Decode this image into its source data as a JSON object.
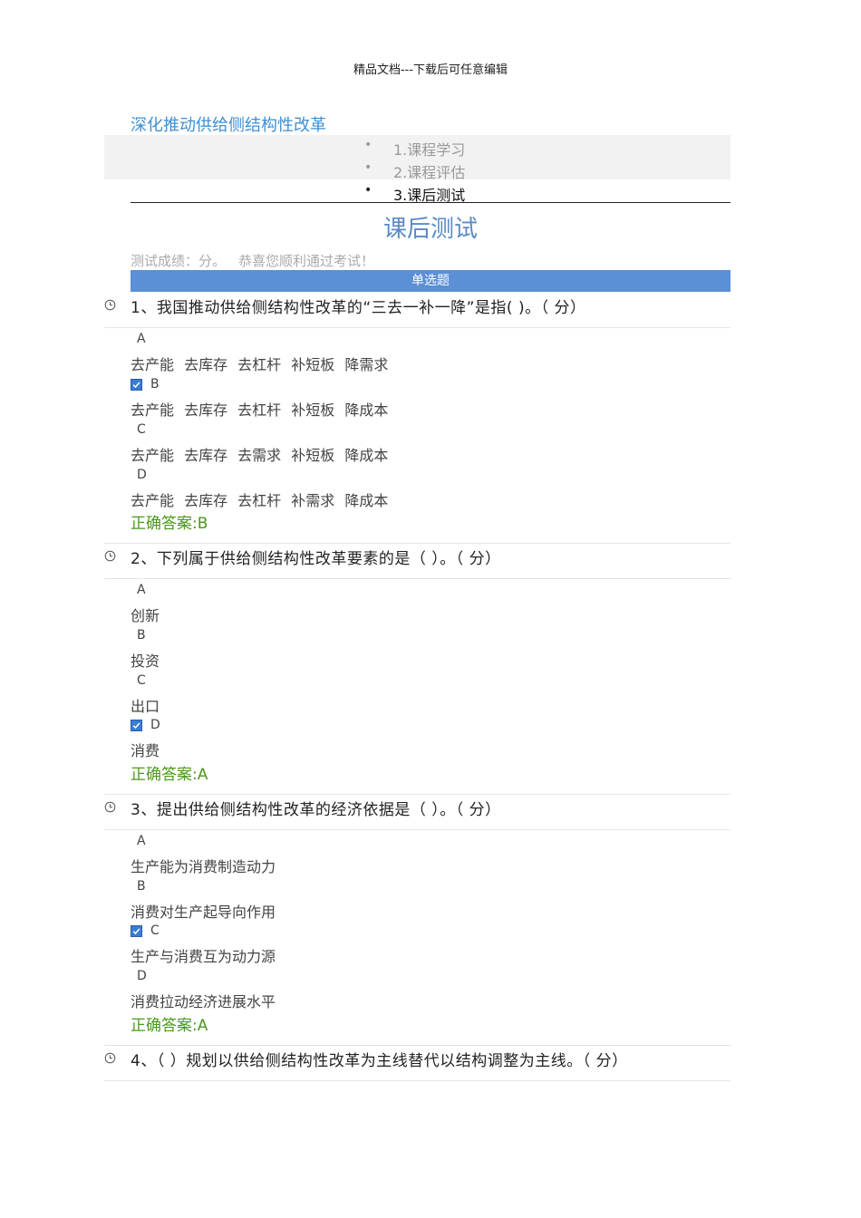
{
  "header_note": "精品文档---下载后可任意编辑",
  "course_title": "深化推动供给侧结构性改革",
  "nav": [
    {
      "label": "1.课程学习",
      "active": false
    },
    {
      "label": "2.课程评估",
      "active": false
    },
    {
      "label": "3.课后测试",
      "active": true
    }
  ],
  "page_heading": "课后测试",
  "score": {
    "label": "测试成绩：分。",
    "message": "恭喜您顺利通过考试！"
  },
  "section_title": "单选题",
  "questions": [
    {
      "text": "1、我国推动供给侧结构性改革的“三去一补一降”是指( )。（ 分）",
      "options": [
        {
          "letter": "A",
          "text": "去产能 去库存 去杠杆 补短板 降需求",
          "checked": false
        },
        {
          "letter": "B",
          "text": "去产能 去库存 去杠杆 补短板 降成本",
          "checked": true
        },
        {
          "letter": "C",
          "text": "去产能 去库存 去需求 补短板 降成本",
          "checked": false
        },
        {
          "letter": "D",
          "text": "去产能 去库存 去杠杆 补需求 降成本",
          "checked": false
        }
      ],
      "answer": "正确答案:B"
    },
    {
      "text": "2、下列属于供给侧结构性改革要素的是（ ）。（ 分）",
      "options": [
        {
          "letter": "A",
          "text": "创新",
          "checked": false
        },
        {
          "letter": "B",
          "text": "投资",
          "checked": false
        },
        {
          "letter": "C",
          "text": "出口",
          "checked": false
        },
        {
          "letter": "D",
          "text": "消费",
          "checked": true
        }
      ],
      "answer": "正确答案:A"
    },
    {
      "text": "3、提出供给侧结构性改革的经济依据是（ ）。（ 分）",
      "options": [
        {
          "letter": "A",
          "text": "生产能为消费制造动力",
          "checked": false
        },
        {
          "letter": "B",
          "text": "消费对生产起导向作用",
          "checked": false
        },
        {
          "letter": "C",
          "text": "生产与消费互为动力源",
          "checked": true
        },
        {
          "letter": "D",
          "text": "消费拉动经济进展水平",
          "checked": false
        }
      ],
      "answer": "正确答案:A"
    },
    {
      "text": "4、（ ）规划以供给侧结构性改革为主线替代以结构调整为主线。（ 分）",
      "options": [],
      "answer": ""
    }
  ]
}
